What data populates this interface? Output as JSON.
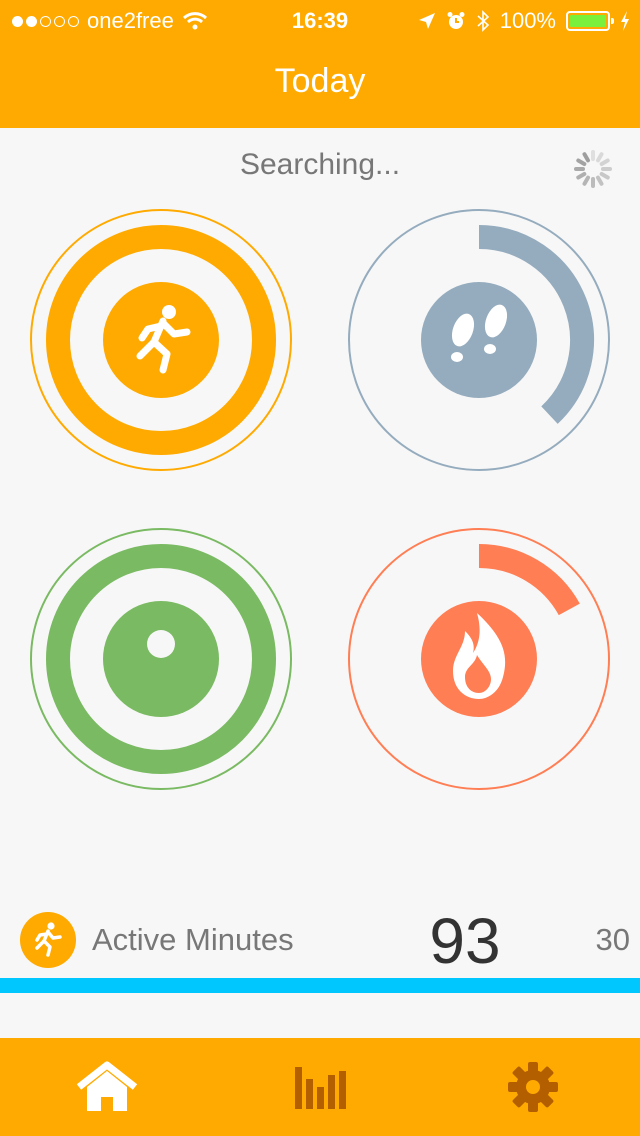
{
  "status_bar": {
    "carrier": "one2free",
    "signal_bars_filled": 2,
    "signal_bars_total": 5,
    "time": "16:39",
    "battery": "100%",
    "battery_level": 1.0,
    "icons": [
      "wifi-icon",
      "location-arrow-icon",
      "alarm-icon",
      "bluetooth-icon",
      "battery-icon",
      "charging-icon"
    ]
  },
  "header": {
    "title": "Today"
  },
  "sync": {
    "status": "Searching...",
    "icon": "spinner-icon"
  },
  "goals": [
    {
      "name": "active-minutes",
      "icon": "running-person-icon",
      "color": "#ffaa00",
      "progress": 1.0
    },
    {
      "name": "steps",
      "icon": "footprints-icon",
      "color": "#95acbe",
      "progress": 0.38
    },
    {
      "name": "distance",
      "icon": "location-pin-icon",
      "color": "#7aba62",
      "progress": 1.0
    },
    {
      "name": "calories",
      "icon": "flame-icon",
      "color": "#ff7e54",
      "progress": 0.17
    }
  ],
  "metric": {
    "label": "Active Minutes",
    "value": "93",
    "goal": "30",
    "progress_fill": 1.0,
    "progress_color": "#00c8ff"
  },
  "tabbar": {
    "tabs": [
      {
        "name": "home",
        "icon": "home-icon",
        "active": true
      },
      {
        "name": "stats",
        "icon": "bar-chart-icon",
        "active": false
      },
      {
        "name": "settings",
        "icon": "gear-icon",
        "active": false
      }
    ]
  }
}
